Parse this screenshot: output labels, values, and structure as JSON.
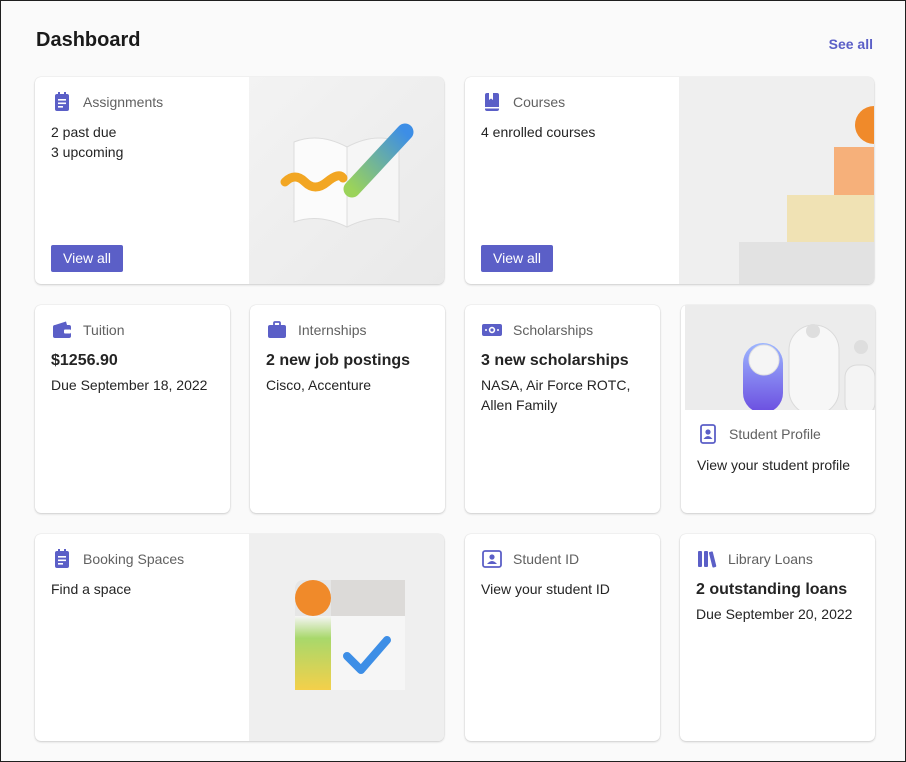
{
  "header": {
    "title": "Dashboard",
    "see_all": "See all"
  },
  "cards": {
    "assignments": {
      "label": "Assignments",
      "line1": "2 past due",
      "line2": "3 upcoming",
      "button": "View all",
      "icon": "assignments-icon"
    },
    "courses": {
      "label": "Courses",
      "line1": "4 enrolled courses",
      "button": "View all",
      "icon": "book-icon"
    },
    "tuition": {
      "label": "Tuition",
      "amount": "$1256.90",
      "due": "Due September 18, 2022",
      "icon": "wallet-icon"
    },
    "internships": {
      "label": "Internships",
      "headline": "2 new job postings",
      "detail": "Cisco, Accenture",
      "icon": "briefcase-icon"
    },
    "scholarships": {
      "label": "Scholarships",
      "headline": "3 new scholarships",
      "detail": "NASA, Air Force ROTC, Allen Family",
      "icon": "money-icon"
    },
    "student_profile": {
      "label": "Student Profile",
      "text": "View your student profile",
      "icon": "profile-icon"
    },
    "booking_spaces": {
      "label": "Booking Spaces",
      "text": "Find a space",
      "icon": "booking-icon"
    },
    "student_id": {
      "label": "Student ID",
      "text": "View your student ID",
      "icon": "id-card-icon"
    },
    "library_loans": {
      "label": "Library Loans",
      "headline": "2 outstanding loans",
      "due": "Due September 20, 2022",
      "icon": "books-icon"
    }
  },
  "colors": {
    "accent": "#5b5fc7",
    "text": "#242424",
    "muted": "#616161"
  }
}
